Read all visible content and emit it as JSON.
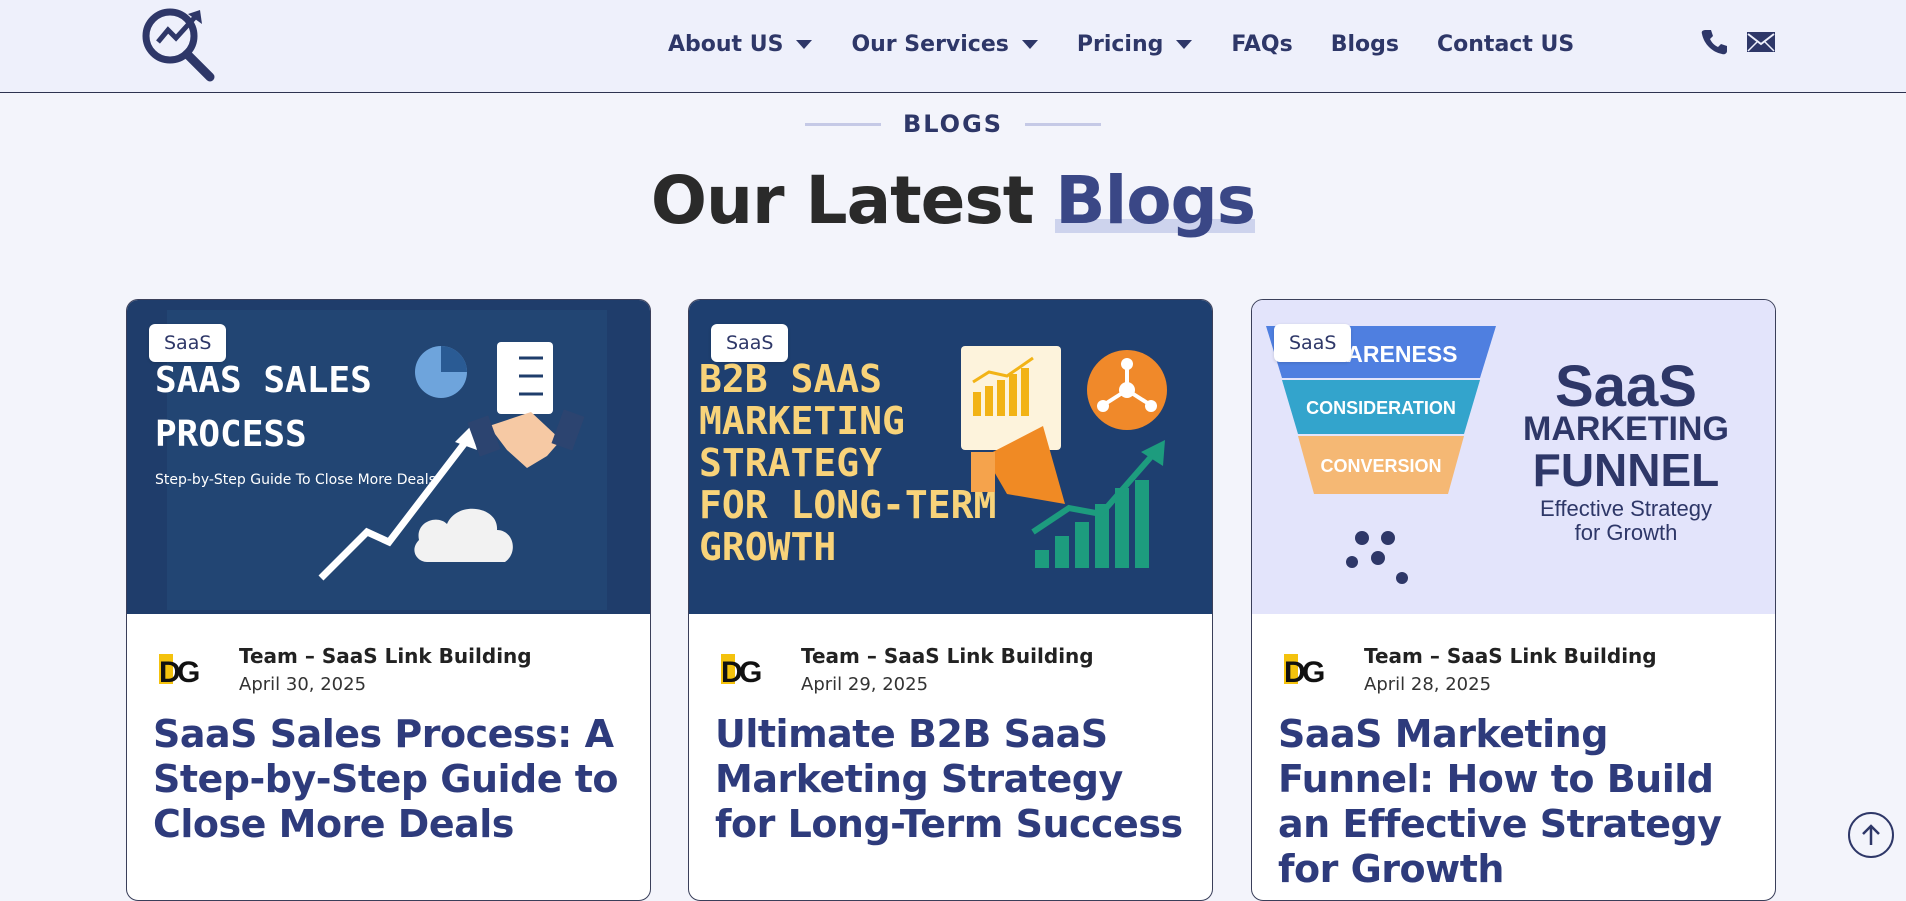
{
  "header": {
    "nav": [
      {
        "label": "About US",
        "caret": true
      },
      {
        "label": "Our Services",
        "caret": true
      },
      {
        "label": "Pricing",
        "caret": true
      },
      {
        "label": "FAQs",
        "caret": false
      },
      {
        "label": "Blogs",
        "caret": false
      },
      {
        "label": "Contact US",
        "caret": false
      }
    ],
    "icons": [
      "phone-icon",
      "mail-icon"
    ]
  },
  "section": {
    "eyebrow": "BLOGS",
    "title_main": "Our Latest",
    "title_highlight": "Blogs"
  },
  "cards": [
    {
      "badge": "SaaS",
      "image_text": {
        "line1": "SAAS SALES",
        "line2": "PROCESS",
        "line3": "Step-by-Step Guide To Close More Deals"
      },
      "author": "Team – SaaS Link Building",
      "date": "April 30, 2025",
      "title": "SaaS Sales Process: A Step-by-Step Guide to Close More Deals"
    },
    {
      "badge": "SaaS",
      "image_text": {
        "line1": "B2B SAAS",
        "line2": "MARKETING",
        "line3": "STRATEGY",
        "line4": "FOR LONG-TERM",
        "line5": "GROWTH"
      },
      "author": "Team – SaaS Link Building",
      "date": "April 29, 2025",
      "title": "Ultimate B2B SaaS Marketing Strategy for Long-Term Success"
    },
    {
      "badge": "SaaS",
      "image_text": {
        "stage1": "AWARENESS",
        "stage2": "CONSIDERATION",
        "stage3": "CONVERSION",
        "big1": "SaaS",
        "big2": "MARKETING",
        "big3": "FUNNEL",
        "sub1": "Effective Strategy",
        "sub2": "for Growth"
      },
      "author": "Team – SaaS Link Building",
      "date": "April 28, 2025",
      "title": "SaaS Marketing Funnel: How to Build an Effective Strategy for Growth"
    }
  ],
  "colors": {
    "brand": "#2e3768",
    "title_blue": "#2e3b7c",
    "page_bg": "#f3f4fb"
  }
}
